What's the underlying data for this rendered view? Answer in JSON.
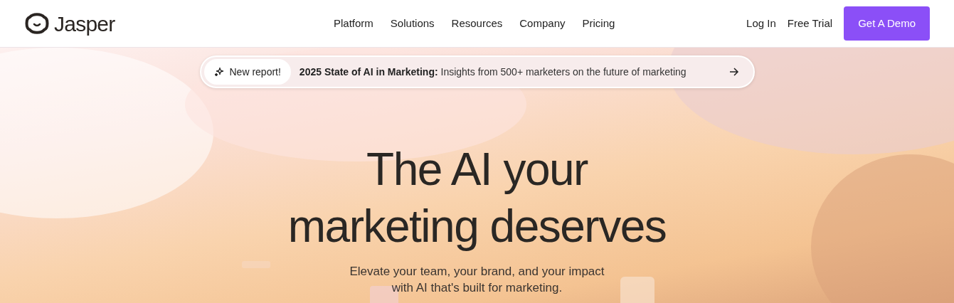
{
  "brand": {
    "name": "Jasper"
  },
  "nav": {
    "links": [
      "Platform",
      "Solutions",
      "Resources",
      "Company",
      "Pricing"
    ],
    "actions": [
      "Log In",
      "Free Trial"
    ],
    "cta": "Get A Demo"
  },
  "announcement": {
    "badge": "New report!",
    "title": "2025 State of AI in Marketing:",
    "text": "Insights from 500+ marketers on the future of marketing"
  },
  "hero": {
    "heading_lines": [
      "The AI your",
      "marketing deserves"
    ],
    "subtitle_lines": [
      "Elevate your team, your brand, and your impact",
      "with AI that's built for marketing."
    ]
  }
}
